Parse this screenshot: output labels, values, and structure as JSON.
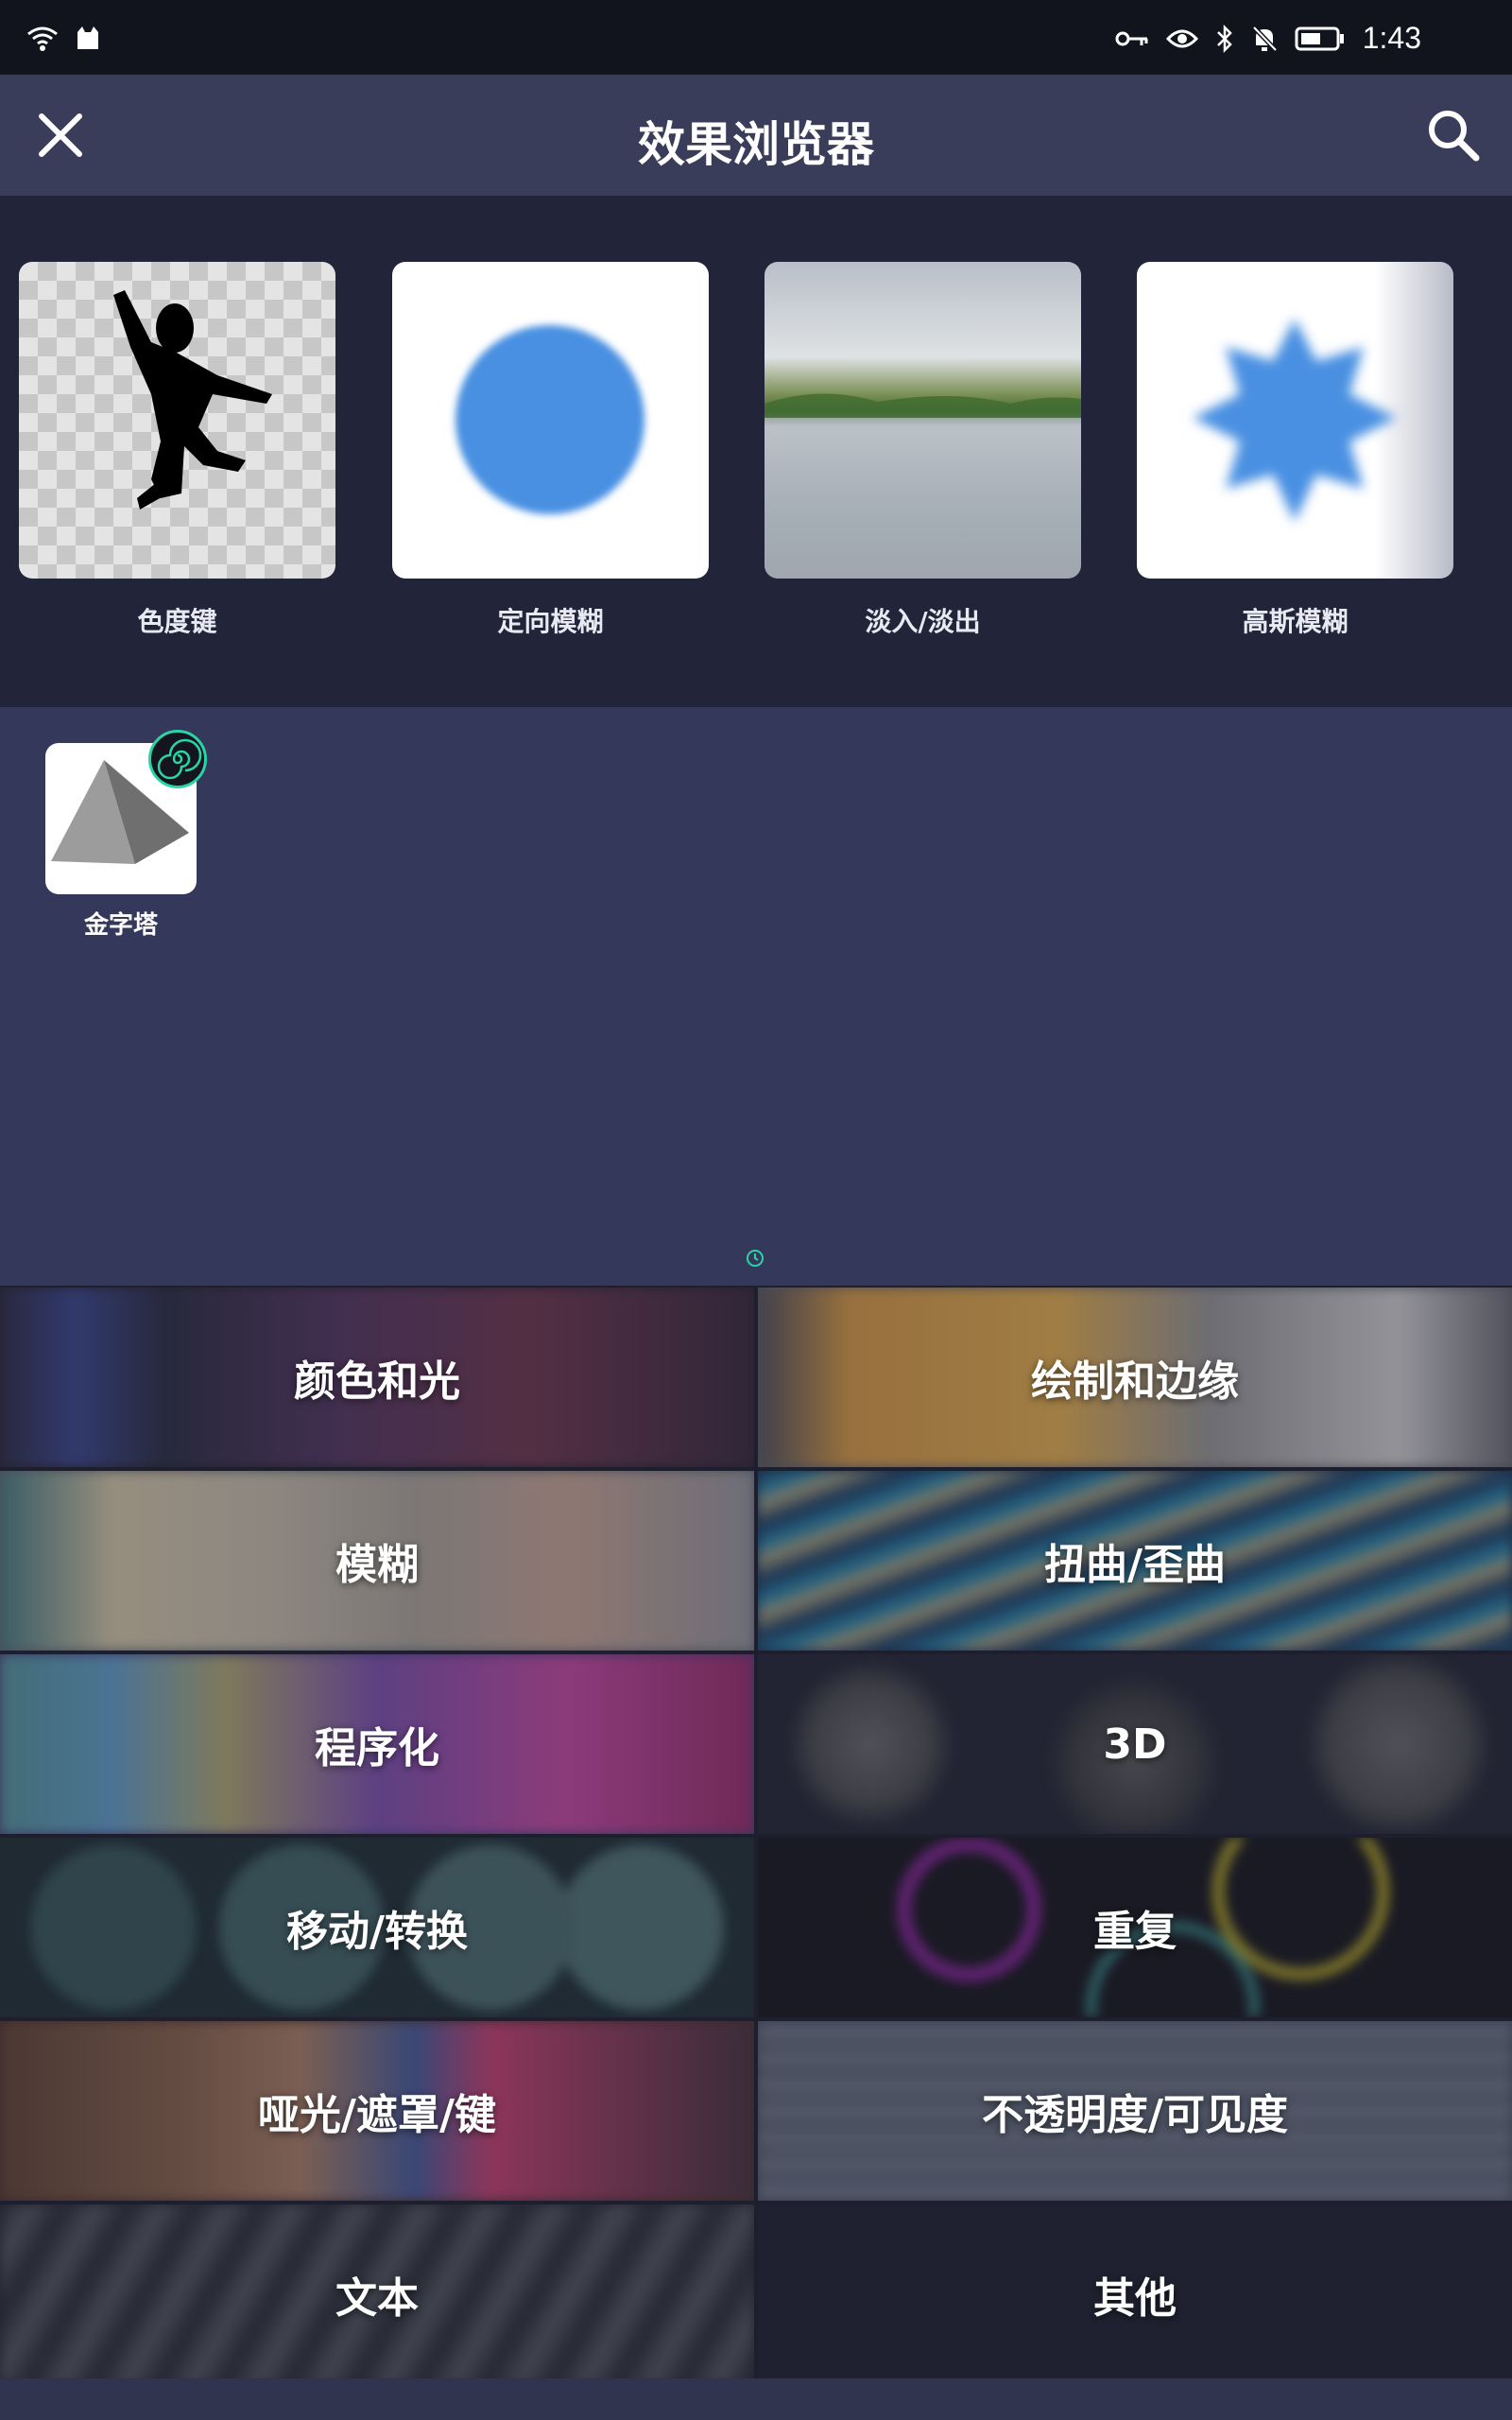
{
  "status_bar": {
    "time": "1:43",
    "icons_left": [
      "wifi-icon",
      "cat-icon"
    ],
    "icons_right": [
      "key-icon",
      "eye-icon",
      "bluetooth-icon",
      "bell-off-icon",
      "battery-icon"
    ]
  },
  "header": {
    "title": "效果浏览器",
    "close_icon": "close-icon",
    "search_icon": "search-icon"
  },
  "featured": [
    {
      "label": "色度键",
      "icon": "silhouette-jump"
    },
    {
      "label": "定向模糊",
      "icon": "blurred-circle"
    },
    {
      "label": "淡入/淡出",
      "icon": "landscape-lake"
    },
    {
      "label": "高斯模糊",
      "icon": "blurred-star"
    }
  ],
  "recent": {
    "items": [
      {
        "label": "金字塔",
        "icon": "pyramid"
      }
    ]
  },
  "categories": [
    {
      "label": "颜色和光"
    },
    {
      "label": "绘制和边缘"
    },
    {
      "label": "模糊"
    },
    {
      "label": "扭曲/歪曲"
    },
    {
      "label": "程序化"
    },
    {
      "label": "3D"
    },
    {
      "label": "移动/转换"
    },
    {
      "label": "重复"
    },
    {
      "label": "哑光/遮罩/键"
    },
    {
      "label": "不透明度/可见度"
    },
    {
      "label": "文本"
    },
    {
      "label": "其他"
    }
  ],
  "colors": {
    "accent_teal": "#2ad4a6",
    "header_bg": "#393d5a",
    "body_bg": "#30344f",
    "blue": "#4a90e2"
  }
}
